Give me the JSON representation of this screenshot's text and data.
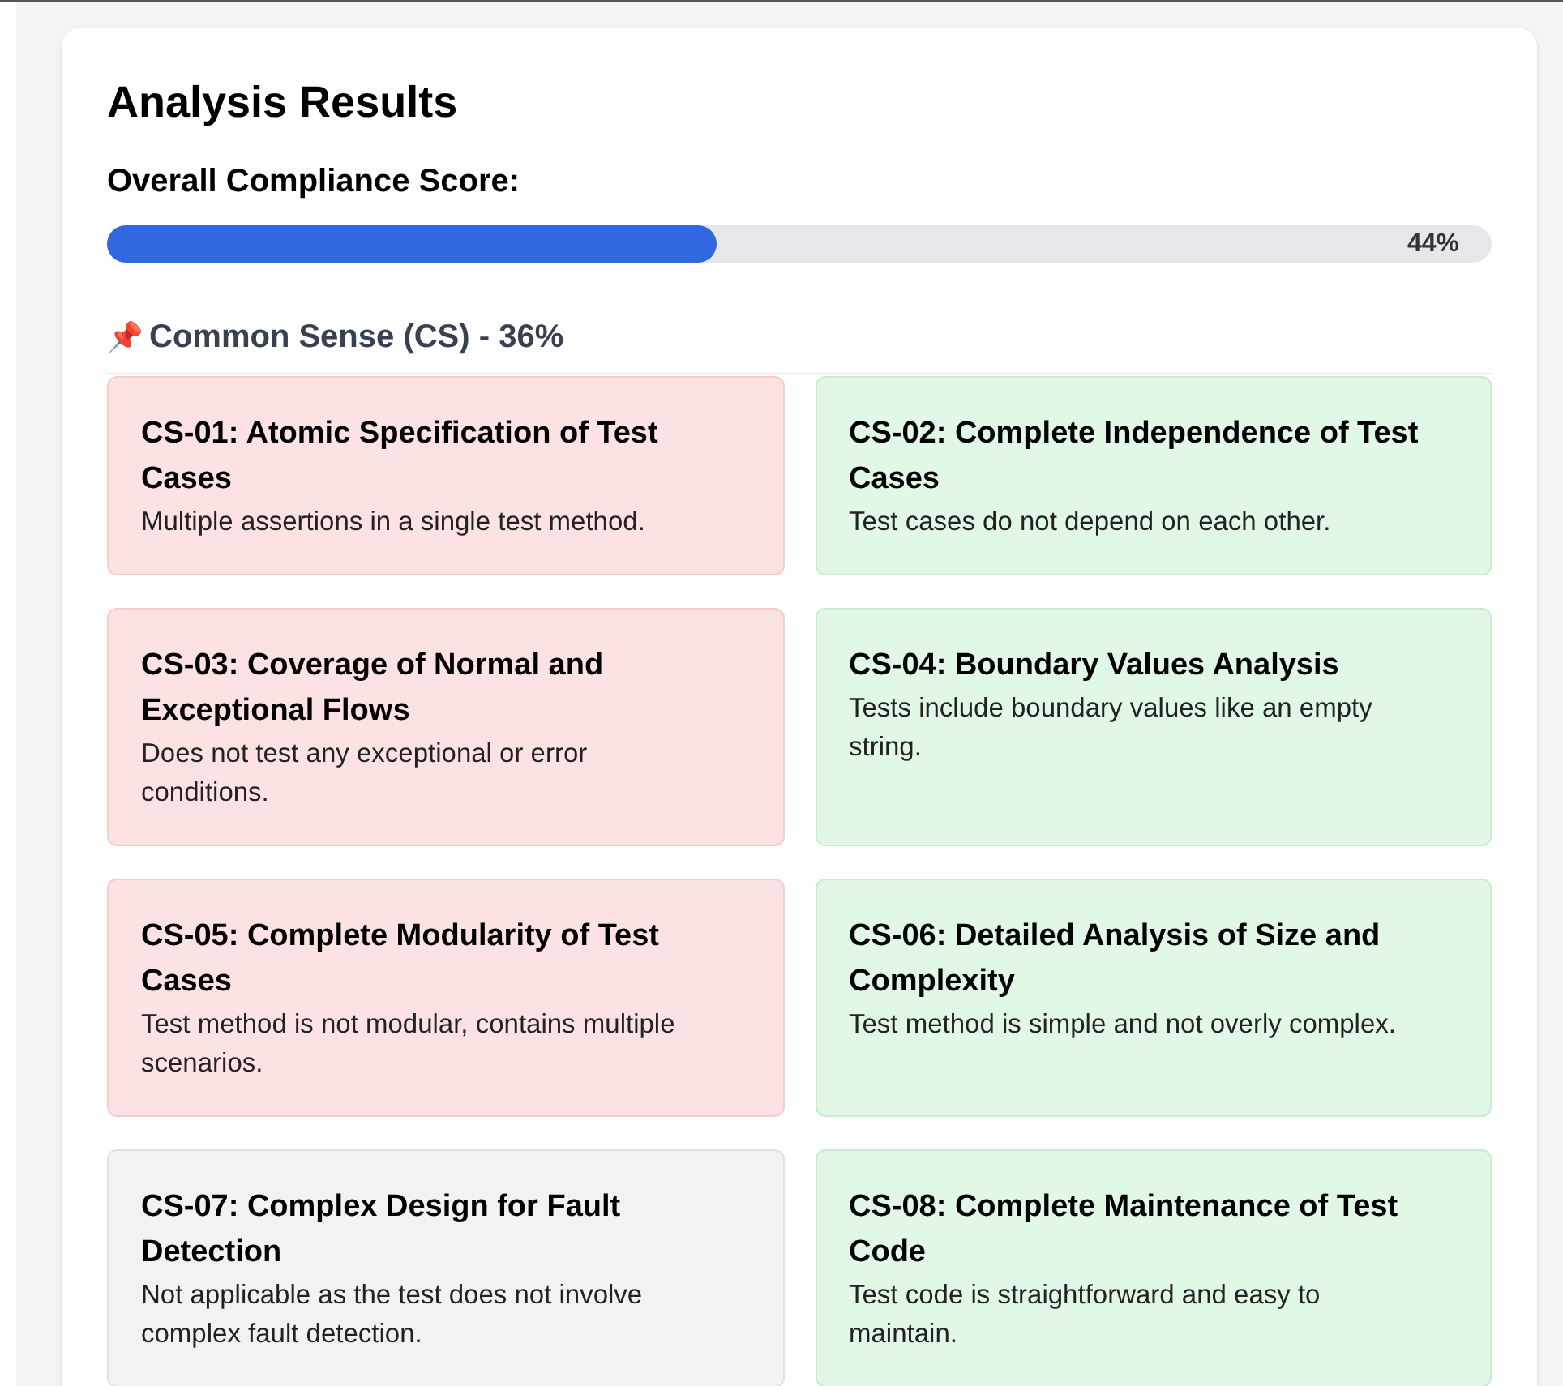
{
  "title": "Analysis Results",
  "overall": {
    "label": "Overall Compliance Score:",
    "level": 0.44,
    "reading": "44%"
  },
  "section": {
    "icon": "📌",
    "title": "Common Sense (CS) - 36%"
  },
  "criteria": [
    {
      "title": "CS-01: Atomic Specification of Test Cases",
      "description": "Multiple assertions in a single test method.",
      "kind": "fail"
    },
    {
      "title": "CS-02: Complete Independence of Test Cases",
      "description": "Test cases do not depend on each other.",
      "kind": "pass"
    },
    {
      "title": "CS-03: Coverage of Normal and Exceptional Flows",
      "description": "Does not test any exceptional or error conditions.",
      "kind": "fail"
    },
    {
      "title": "CS-04: Boundary Values Analysis",
      "description": "Tests include boundary values like an empty string.",
      "kind": "pass"
    },
    {
      "title": "CS-05: Complete Modularity of Test Cases",
      "description": "Test method is not modular, contains multiple scenarios.",
      "kind": "fail"
    },
    {
      "title": "CS-06: Detailed Analysis of Size and Complexity",
      "description": "Test method is simple and not overly complex.",
      "kind": "pass"
    },
    {
      "title": "CS-07: Complex Design for Fault Detection",
      "description": "Not applicable as the test does not involve complex fault detection.",
      "kind": "na"
    },
    {
      "title": "CS-08: Complete Maintenance of Test Code",
      "description": "Test code is straightforward and easy to maintain.",
      "kind": "pass"
    }
  ]
}
